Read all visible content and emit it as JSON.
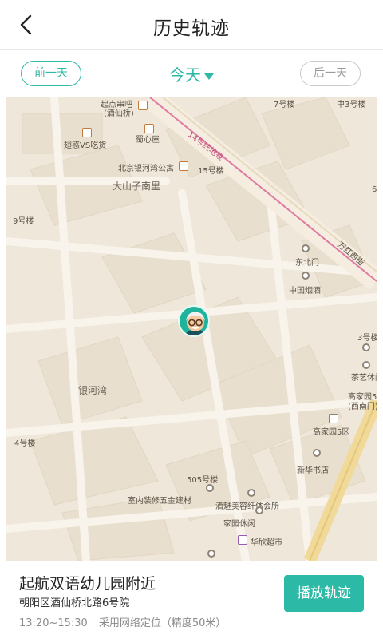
{
  "header": {
    "title": "历史轨迹",
    "back_icon": "chevron-left-icon"
  },
  "datebar": {
    "prev_label": "前一天",
    "today_label": "今天",
    "next_label": "后一天"
  },
  "map": {
    "labels": {
      "qidian": "起点串吧",
      "jiuxianqiao": "(酒仙桥)",
      "qianhuo_lbl": "翅惑VS吃货",
      "shuxin": "蜀心屋",
      "gongyu": "北京银河湾公寓",
      "lou15": "15号楼",
      "dashanzi": "大山子南里",
      "lou7": "7号楼",
      "lou3top": "中3号楼",
      "lou9": "9号楼",
      "dongbeimen": "东北门",
      "yancao": "中国烟酒",
      "lou3": "3号楼",
      "chayi": "茶艺休闲",
      "gaojia_west": "高家园5区",
      "ximenn": "(西南门)",
      "gaojia5": "高家园5区",
      "xinhua": "新华书店",
      "yinhewan": "银河湾",
      "lou4": "4号楼",
      "lou505": "505号楼",
      "zhuangxiu": "室内装修五金建材",
      "jiumei": "酒魅美容纤体会所",
      "jiayuan": "家园休闲",
      "huaxin": "华欣超市",
      "wanhong": "万红西街",
      "metro": "14号线地铁",
      "lou6": "6"
    }
  },
  "panel": {
    "place": "起航双语幼儿园附近",
    "address": "朝阳区酒仙桥北路6号院",
    "time_range": "13:20~15:30",
    "locate_mode": "采用网络定位（精度50米）",
    "play_label": "播放轨迹"
  },
  "colors": {
    "accent": "#2cb9a5",
    "map_bg": "#efe7da",
    "road": "#f7f2e9",
    "metro": "#e07aa0"
  }
}
